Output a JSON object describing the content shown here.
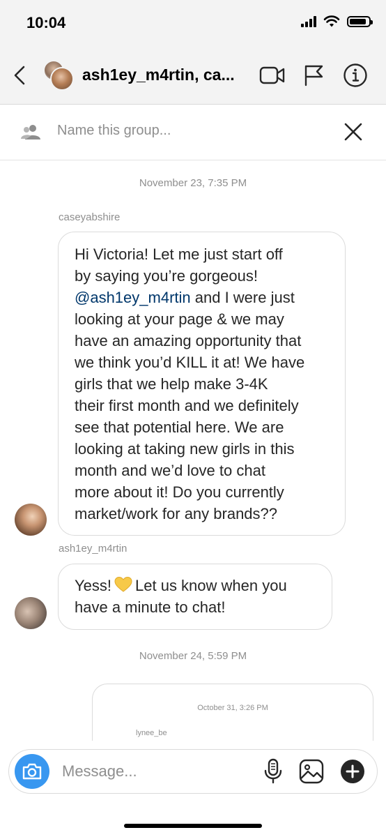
{
  "status_bar": {
    "time": "10:04",
    "battery_level": 0.9
  },
  "header": {
    "title": "ash1ey_m4rtin, ca...",
    "icons": [
      "back-chevron-icon",
      "video-call-icon",
      "report-flag-icon",
      "info-icon"
    ]
  },
  "group": {
    "placeholder": "Name this group..."
  },
  "messages": {
    "stamp1": "November 23, 7:35 PM",
    "sender1": "caseyabshire",
    "m1_line1": "Hi Victoria! Let me just start off",
    "m1_line2": "by saying you’re gorgeous!",
    "m1_mention": "@ash1ey_m4rtin",
    "m1_line3_rest": " and I were just",
    "m1_line4": "looking at your page & we may",
    "m1_line5": "have an amazing opportunity that",
    "m1_line6": "we think you’d KILL it at! We have",
    "m1_line7": "girls that we help make 3-4K",
    "m1_line8": "their first month and we definitely",
    "m1_line9": "see that potential here. We are",
    "m1_line10": "looking at taking new girls in this",
    "m1_line11": "month and we’d love to chat",
    "m1_line12": "more about it! Do you currently",
    "m1_line13": "market/work for any brands??",
    "sender2": "ash1ey_m4rtin",
    "m2_line1_a": "Yess!",
    "m2_line1_b": "Let us know when you",
    "m2_line2": "have a minute to chat!",
    "stamp2": "November 24, 5:59 PM",
    "shared_stamp": "October 31, 3:26 PM",
    "shared_sender": "lynee_be"
  },
  "composer": {
    "placeholder": "Message..."
  },
  "colors": {
    "accent": "#3897f0",
    "mention": "#00376b",
    "heart": "#f7c948"
  }
}
